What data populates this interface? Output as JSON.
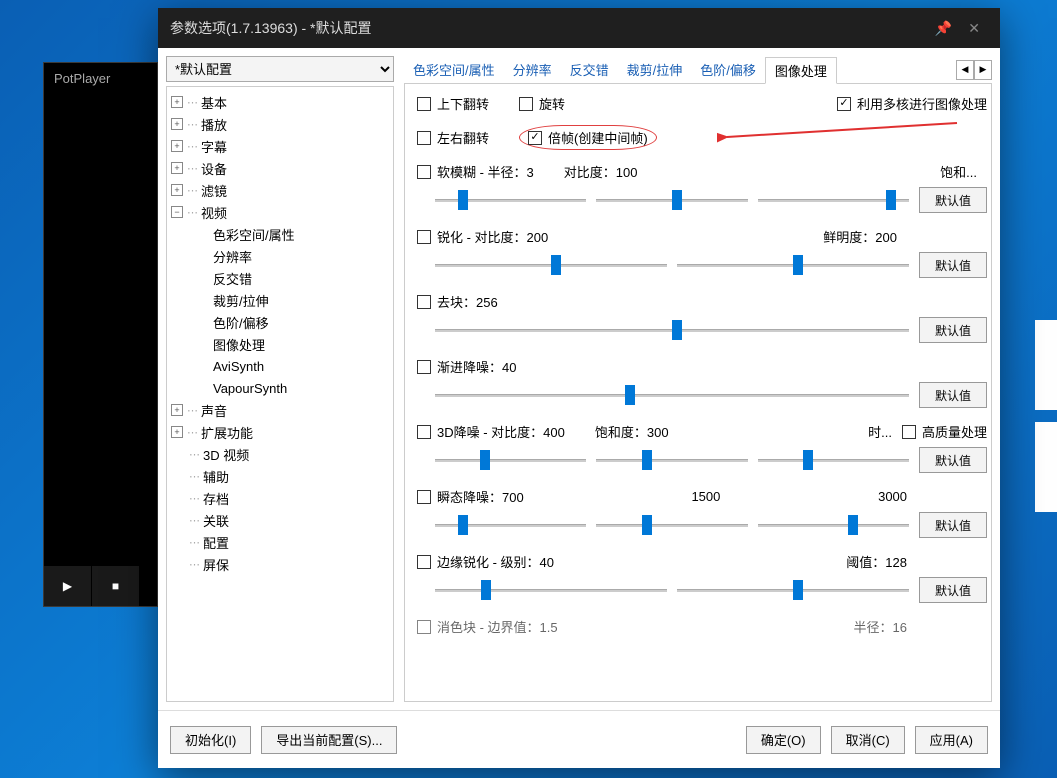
{
  "potplayer": {
    "title": "PotPlayer"
  },
  "dialog": {
    "title": "参数选项(1.7.13963) - *默认配置",
    "profile": "*默认配置",
    "tree": {
      "basic": "基本",
      "playback": "播放",
      "subtitle": "字幕",
      "device": "设备",
      "filter": "滤镜",
      "video": "视频",
      "video_children": {
        "colorspace": "色彩空间/属性",
        "resolution": "分辨率",
        "deinterlace": "反交错",
        "crop": "裁剪/拉伸",
        "levels": "色阶/偏移",
        "imageproc": "图像处理",
        "avisynth": "AviSynth",
        "vapoursynth": "VapourSynth"
      },
      "audio": "声音",
      "extended": "扩展功能",
      "v3d": "3D 视频",
      "assist": "辅助",
      "archive": "存档",
      "assoc": "关联",
      "config": "配置",
      "screensaver": "屏保"
    },
    "tabs": {
      "colorspace": "色彩空间/属性",
      "resolution": "分辨率",
      "deinterlace": "反交错",
      "crop": "裁剪/拉伸",
      "levels": "色阶/偏移",
      "imageproc": "图像处理"
    },
    "panel": {
      "flip_v": "上下翻转",
      "rotate": "旋转",
      "multicore": "利用多核进行图像处理",
      "flip_h": "左右翻转",
      "doubleframe": "倍帧(创建中间帧)",
      "softblur": {
        "label": "软模糊 - 半径：3",
        "contrast": "对比度：100",
        "saturation": "饱和..."
      },
      "sharpen": {
        "label": "锐化 - 对比度：200",
        "clarity": "鲜明度：200"
      },
      "deblock": {
        "label": "去块：256"
      },
      "gradual": {
        "label": "渐进降噪：40"
      },
      "nr3d": {
        "label": "3D降噪 - 对比度：400",
        "saturation": "饱和度：300",
        "time": "时...",
        "hq": "高质量处理"
      },
      "temporal": {
        "label": "瞬态降噪：700",
        "v2": "1500",
        "v3": "3000"
      },
      "edge": {
        "label": "边缘锐化 - 级别：40",
        "threshold": "阈值：128"
      },
      "last": {
        "label": "消色块 - 边界值：1.5",
        "radius": "半径：16"
      },
      "default_btn": "默认值"
    },
    "footer": {
      "init": "初始化(I)",
      "export": "导出当前配置(S)...",
      "ok": "确定(O)",
      "cancel": "取消(C)",
      "apply": "应用(A)"
    }
  }
}
